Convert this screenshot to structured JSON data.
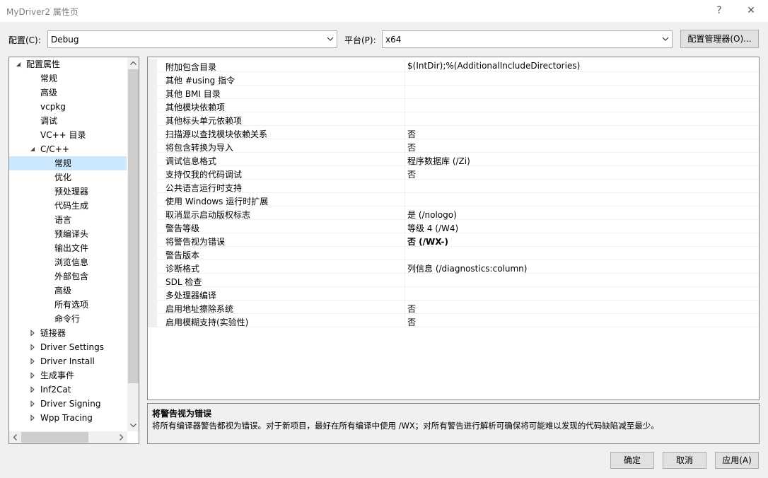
{
  "window": {
    "title": "MyDriver2 属性页",
    "help_glyph": "?",
    "close_glyph": "✕"
  },
  "toolbar": {
    "config_label": "配置(C):",
    "config_value": "Debug",
    "platform_label": "平台(P):",
    "platform_value": "x64",
    "manager_label": "配置管理器(O)..."
  },
  "tree": {
    "items": [
      {
        "label": "配置属性",
        "level": 0,
        "state": "expanded"
      },
      {
        "label": "常规",
        "level": 1
      },
      {
        "label": "高级",
        "level": 1
      },
      {
        "label": "vcpkg",
        "level": 1
      },
      {
        "label": "调试",
        "level": 1
      },
      {
        "label": "VC++ 目录",
        "level": 1
      },
      {
        "label": "C/C++",
        "level": 1,
        "state": "expanded"
      },
      {
        "label": "常规",
        "level": 2,
        "selected": true
      },
      {
        "label": "优化",
        "level": 2
      },
      {
        "label": "预处理器",
        "level": 2
      },
      {
        "label": "代码生成",
        "level": 2
      },
      {
        "label": "语言",
        "level": 2
      },
      {
        "label": "预编译头",
        "level": 2
      },
      {
        "label": "输出文件",
        "level": 2
      },
      {
        "label": "浏览信息",
        "level": 2
      },
      {
        "label": "外部包含",
        "level": 2
      },
      {
        "label": "高级",
        "level": 2
      },
      {
        "label": "所有选项",
        "level": 2
      },
      {
        "label": "命令行",
        "level": 2
      },
      {
        "label": "链接器",
        "level": 1,
        "state": "collapsed"
      },
      {
        "label": "Driver Settings",
        "level": 1,
        "state": "collapsed"
      },
      {
        "label": "Driver Install",
        "level": 1,
        "state": "collapsed"
      },
      {
        "label": "生成事件",
        "level": 1,
        "state": "collapsed"
      },
      {
        "label": "Inf2Cat",
        "level": 1,
        "state": "collapsed"
      },
      {
        "label": "Driver Signing",
        "level": 1,
        "state": "collapsed"
      },
      {
        "label": "Wpp Tracing",
        "level": 1,
        "state": "collapsed"
      }
    ]
  },
  "grid": {
    "rows": [
      {
        "name": "附加包含目录",
        "value": "$(IntDir);%(AdditionalIncludeDirectories)"
      },
      {
        "name": "其他 #using 指令",
        "value": ""
      },
      {
        "name": "其他 BMI 目录",
        "value": ""
      },
      {
        "name": "其他模块依赖项",
        "value": ""
      },
      {
        "name": "其他标头单元依赖项",
        "value": ""
      },
      {
        "name": "扫描源以查找模块依赖关系",
        "value": "否"
      },
      {
        "name": "将包含转换为导入",
        "value": "否"
      },
      {
        "name": "调试信息格式",
        "value": "程序数据库 (/Zi)"
      },
      {
        "name": "支持仅我的代码调试",
        "value": "否"
      },
      {
        "name": "公共语言运行时支持",
        "value": ""
      },
      {
        "name": "使用 Windows 运行时扩展",
        "value": ""
      },
      {
        "name": "取消显示启动版权标志",
        "value": "是 (/nologo)"
      },
      {
        "name": "警告等级",
        "value": "等级 4 (/W4)"
      },
      {
        "name": "将警告视为错误",
        "value": "否 (/WX-)",
        "active": true
      },
      {
        "name": "警告版本",
        "value": ""
      },
      {
        "name": "诊断格式",
        "value": "列信息 (/diagnostics:column)"
      },
      {
        "name": "SDL 检查",
        "value": ""
      },
      {
        "name": "多处理器编译",
        "value": ""
      },
      {
        "name": "启用地址擦除系统",
        "value": "否"
      },
      {
        "name": "启用模糊支持(实验性)",
        "value": "否"
      }
    ]
  },
  "description": {
    "title": "将警告视为错误",
    "text": "将所有编译器警告都视为错误。对于新项目，最好在所有编译中使用 /WX；对所有警告进行解析可确保将可能难以发现的代码缺陷减至最少。"
  },
  "buttons": {
    "ok": "确定",
    "cancel": "取消",
    "apply": "应用(A)"
  }
}
